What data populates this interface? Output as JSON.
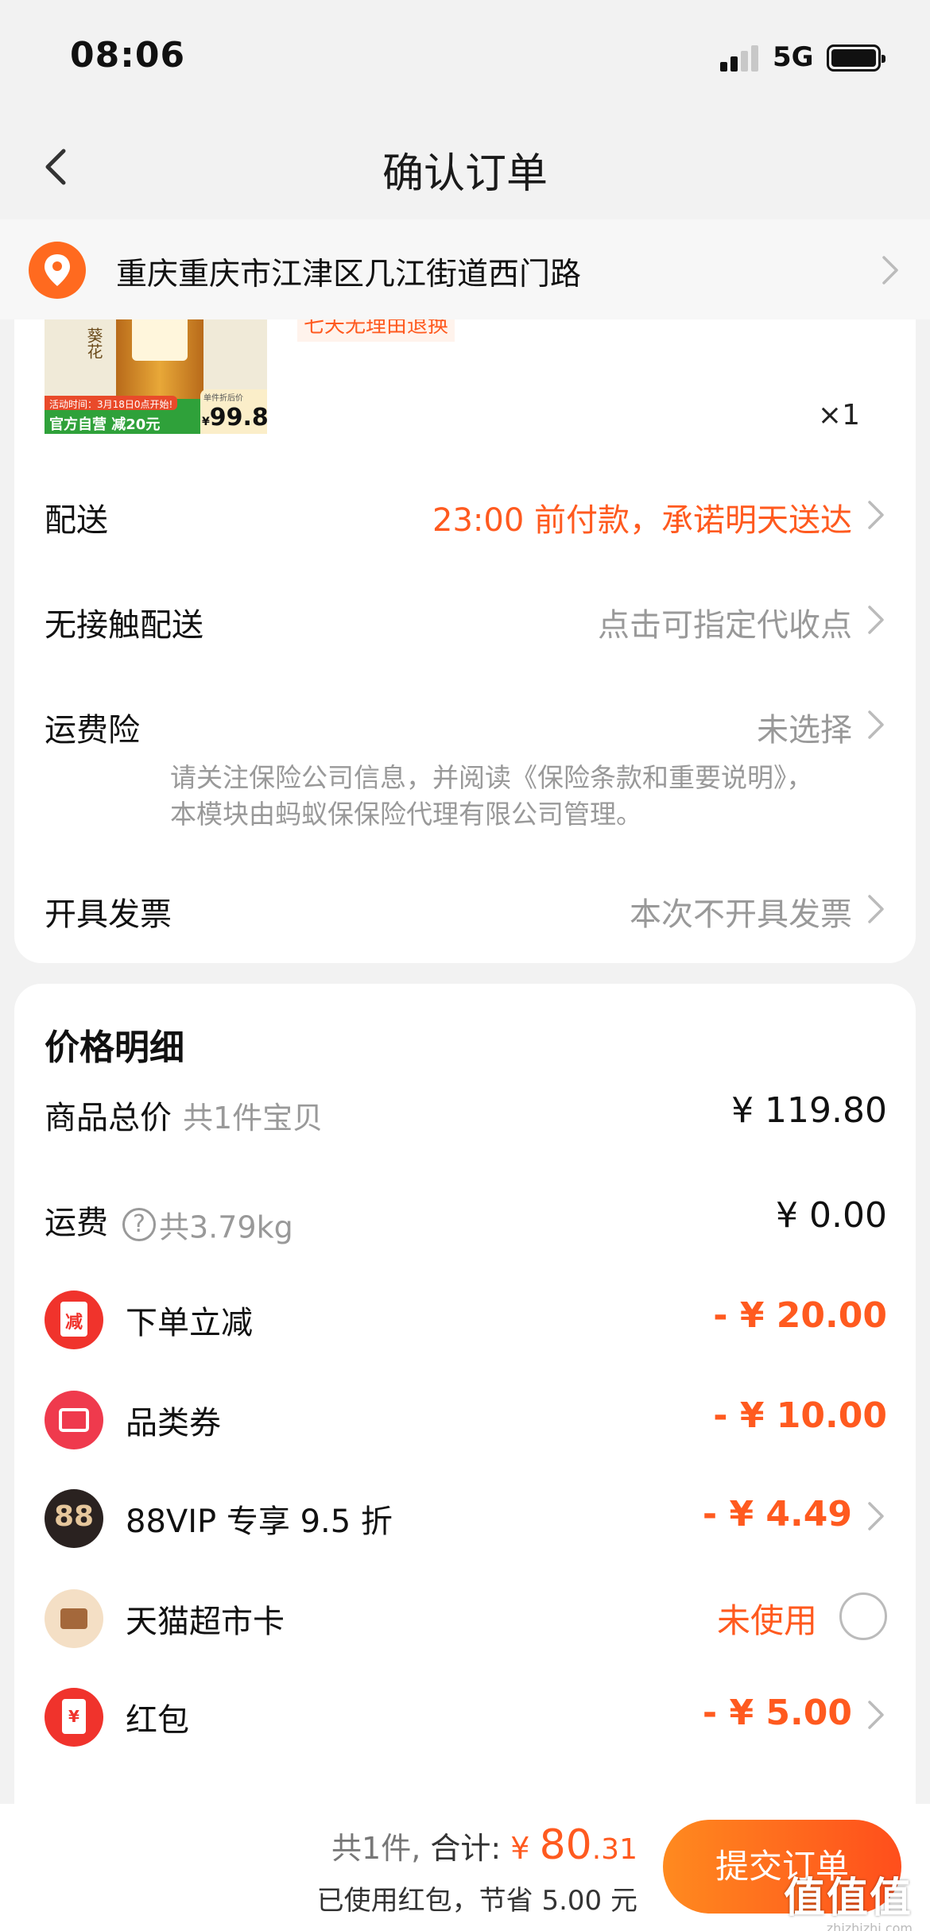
{
  "status": {
    "time": "08:06",
    "network": "5G"
  },
  "nav": {
    "title": "确认订单",
    "back": "back"
  },
  "address": {
    "text": "重庆重庆市江津区几江街道西门路"
  },
  "product": {
    "image_label": "葵花",
    "promo_tag": "活动时间：3月18日0点开始!",
    "official_tag": "官方自营  减20元",
    "unit_price_label": "单件折后价",
    "unit_price_symbol": "¥",
    "unit_price": "99.8",
    "return_tag": "七天无理由退换",
    "quantity": "×1"
  },
  "order_rows": [
    {
      "label": "配送",
      "value": "23:00 前付款，承诺明天送达"
    },
    {
      "label": "无接触配送",
      "value": "点击可指定代收点"
    },
    {
      "label": "运费险",
      "value": "未选择"
    },
    {
      "label": "开具发票",
      "value": "本次不开具发票"
    }
  ],
  "insurance_note": "请关注保险公司信息，并阅读《保险条款和重要说明》，本模块由蚂蚁保保险代理有限公司管理。",
  "price": {
    "heading": "价格明细",
    "goods_total": {
      "label": "商品总价",
      "sub": "共1件宝贝",
      "amount": "¥ 119.80"
    },
    "shipping": {
      "label": "运费",
      "help": "?",
      "weight": "共3.79kg",
      "amount": "¥ 0.00"
    },
    "instant_discount": {
      "label": "下单立减",
      "icon_text": "减",
      "amount": "- ¥ 20.00"
    },
    "category_coupon": {
      "label": "品类券",
      "amount": "- ¥ 10.00"
    },
    "vip": {
      "label": "88VIP 专享 9.5 折",
      "icon_text": "88",
      "amount": "- ¥ 4.49"
    },
    "market_card": {
      "label": "天猫超市卡",
      "status": "未使用"
    },
    "red_packet": {
      "label": "红包",
      "icon_text": "¥",
      "amount": "- ¥ 5.00"
    }
  },
  "footer": {
    "count": "共1件,",
    "total_label": "合计:",
    "currency": "¥",
    "total_int": "80",
    "total_dec": ".31",
    "saving": "已使用红包，节省 5.00 元",
    "submit": "提交订单"
  },
  "watermark": {
    "main": "值值值",
    "site": "zhizhizhi.com"
  },
  "colors": {
    "accent": "#ff5a1f",
    "muted": "#999999",
    "background": "#f2f2f2"
  }
}
